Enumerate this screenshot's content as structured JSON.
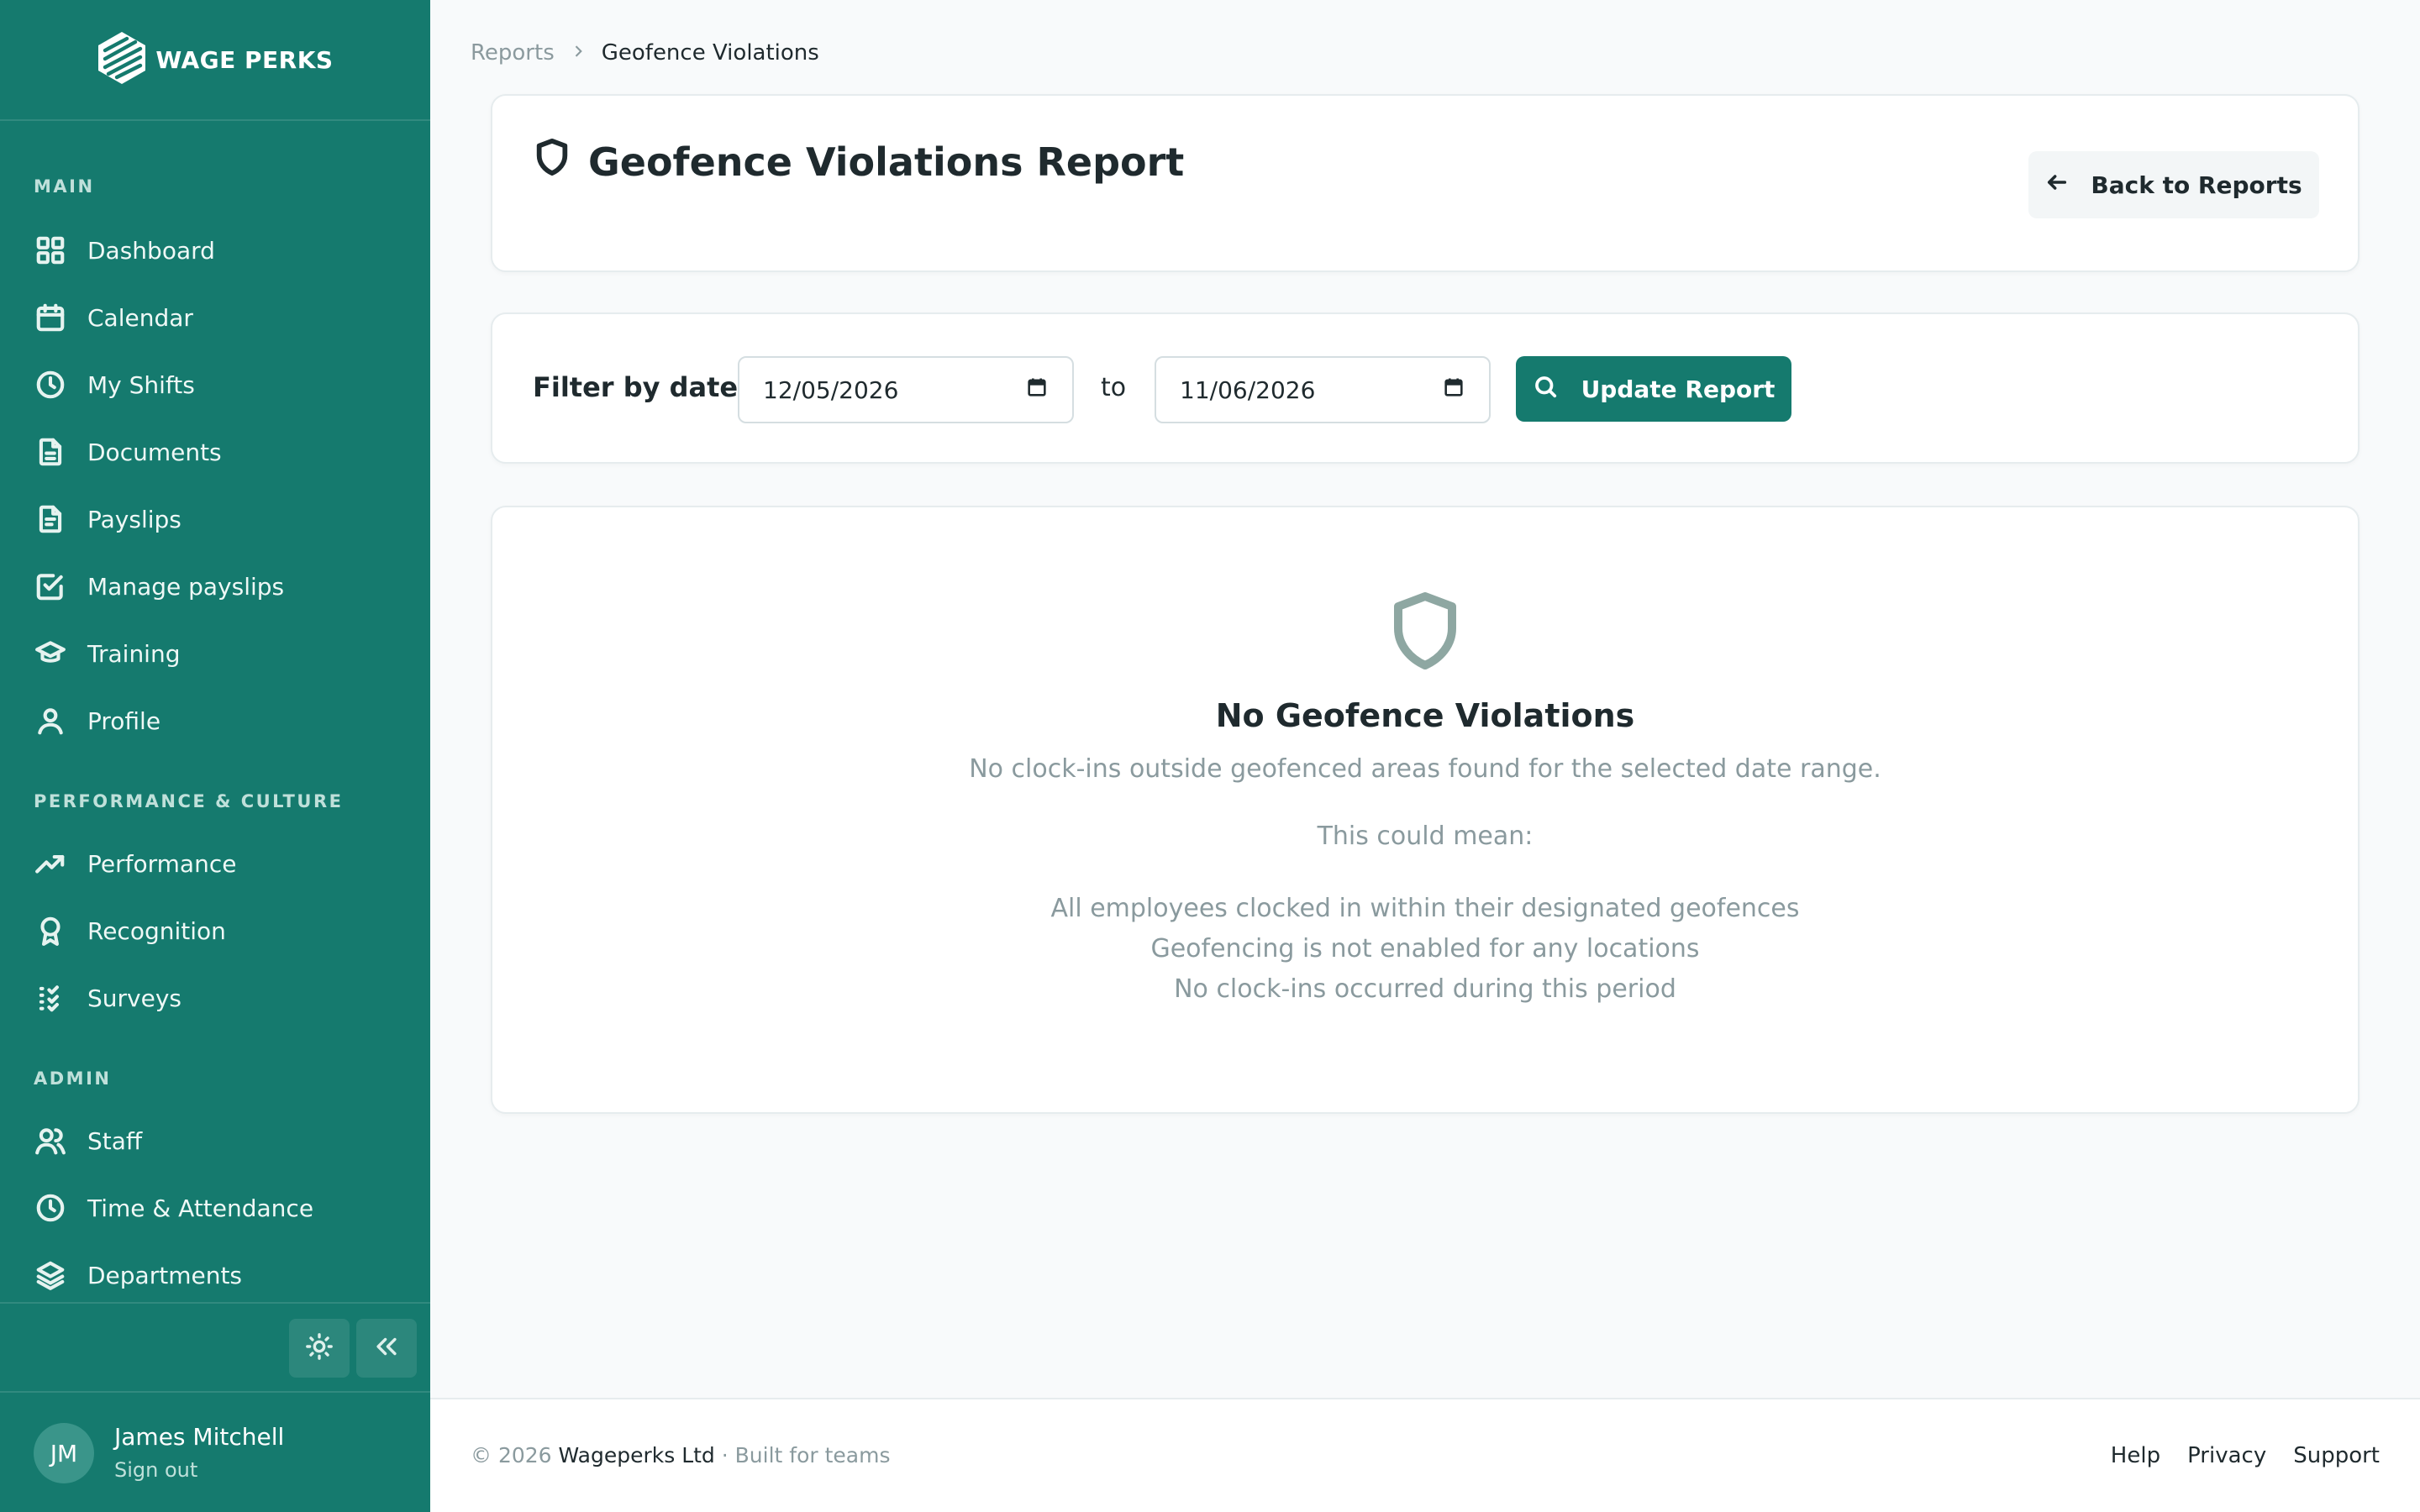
{
  "app": {
    "brand": "WAGE PERKS",
    "logo_icon": "wage-perks-logo"
  },
  "sidebar": {
    "sections": [
      {
        "label": "MAIN",
        "items": [
          {
            "label": "Dashboard",
            "icon": "grid-icon"
          },
          {
            "label": "Calendar",
            "icon": "calendar-icon"
          },
          {
            "label": "My Shifts",
            "icon": "clock-icon"
          },
          {
            "label": "Documents",
            "icon": "document-icon"
          },
          {
            "label": "Payslips",
            "icon": "payslip-icon"
          },
          {
            "label": "Manage payslips",
            "icon": "checkbox-icon"
          },
          {
            "label": "Training",
            "icon": "graduation-cap-icon"
          },
          {
            "label": "Profile",
            "icon": "user-icon"
          }
        ]
      },
      {
        "label": "PERFORMANCE & CULTURE",
        "items": [
          {
            "label": "Performance",
            "icon": "trend-up-icon"
          },
          {
            "label": "Recognition",
            "icon": "award-icon"
          },
          {
            "label": "Surveys",
            "icon": "checklist-icon"
          }
        ]
      },
      {
        "label": "ADMIN",
        "items": [
          {
            "label": "Staff",
            "icon": "users-icon"
          },
          {
            "label": "Time & Attendance",
            "icon": "clock-icon"
          },
          {
            "label": "Departments",
            "icon": "layers-icon"
          }
        ]
      }
    ],
    "user": {
      "initials": "JM",
      "name": "James Mitchell",
      "sign_out": "Sign out"
    }
  },
  "breadcrumb": {
    "parent": "Reports",
    "current": "Geofence Violations"
  },
  "header": {
    "title": "Geofence Violations Report",
    "back_label": "Back to Reports"
  },
  "filter": {
    "label": "Filter by date:",
    "start_date": "12/05/2026",
    "to_label": "to",
    "end_date": "11/06/2026",
    "update_label": "Update Report"
  },
  "empty_state": {
    "title": "No Geofence Violations",
    "subtitle": "No clock-ins outside geofenced areas found for the selected date range.",
    "could_mean": "This could mean:",
    "reasons": [
      "All employees clocked in within their designated geofences",
      "Geofencing is not enabled for any locations",
      "No clock-ins occurred during this period"
    ]
  },
  "footer": {
    "copyright": "© 2026 ",
    "company": "Wageperks Ltd",
    "tagline": " · Built for teams",
    "links": [
      "Help",
      "Privacy",
      "Support"
    ]
  },
  "colors": {
    "sidebar_bg": "#157a6e",
    "primary": "#157a6e",
    "page_bg": "#f8fafb",
    "muted_text": "#8a9a9e"
  }
}
